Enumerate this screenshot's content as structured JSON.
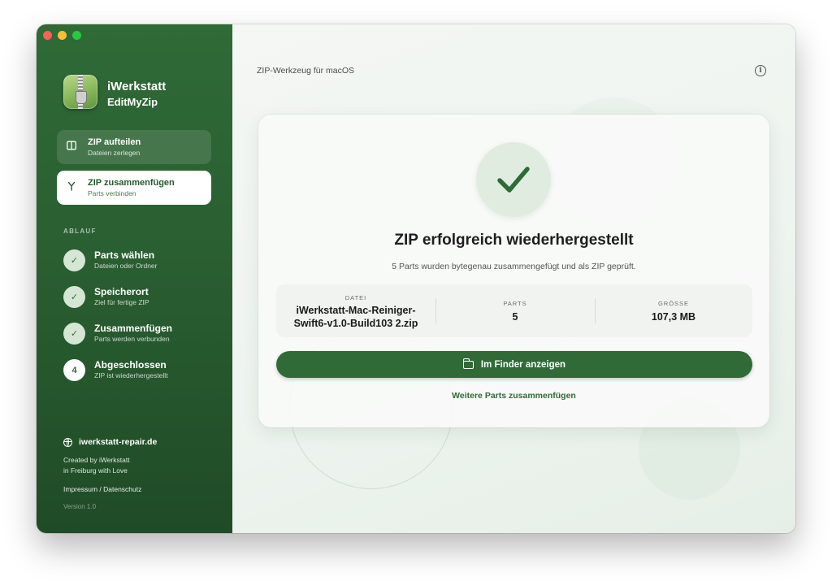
{
  "app": {
    "name": "iWerkstatt",
    "subtitle": "EditMyZip"
  },
  "nav": [
    {
      "title": "ZIP aufteilen",
      "subtitle": "Dateien zerlegen",
      "icon": "split-icon",
      "active": false
    },
    {
      "title": "ZIP zusammenfügen",
      "subtitle": "Parts verbinden",
      "icon": "merge-icon",
      "active": true
    }
  ],
  "workflow": {
    "heading": "ABLAUF",
    "steps": [
      {
        "marker": "✓",
        "title": "Parts wählen",
        "subtitle": "Dateien oder Ordner",
        "state": "done"
      },
      {
        "marker": "✓",
        "title": "Speicherort",
        "subtitle": "Ziel für fertige ZIP",
        "state": "done"
      },
      {
        "marker": "✓",
        "title": "Zusammenfügen",
        "subtitle": "Parts werden verbunden",
        "state": "done"
      },
      {
        "marker": "4",
        "title": "Abgeschlossen",
        "subtitle": "ZIP ist wiederhergestellt",
        "state": "current"
      }
    ]
  },
  "footer": {
    "website": "iwerkstatt-repair.de",
    "credit_line1": "Created by iWerkstatt",
    "credit_line2": "in Freiburg with Love",
    "legal": "Impressum / Datenschutz",
    "version": "Version 1.0"
  },
  "main": {
    "title": "ZIP-Werkzeug für macOS",
    "result": {
      "title": "ZIP erfolgreich wiederhergestellt",
      "subtitle": "5 Parts wurden bytegenau zusammengefügt und als ZIP geprüft.",
      "file_label": "DATEI",
      "file_line1": "iWerkstatt-Mac-Reiniger-",
      "file_line2": "Swift6-v1.0-Build103 2.zip",
      "parts_label": "PARTS",
      "parts_value": "5",
      "size_label": "GRÖSSE",
      "size_value": "107,3 MB",
      "primary_button": "Im Finder anzeigen",
      "secondary_link": "Weitere Parts zusammenfügen"
    }
  },
  "colors": {
    "accent": "#2f6a37",
    "sidebar": "#2a5f31",
    "background": "#eef4ef"
  }
}
